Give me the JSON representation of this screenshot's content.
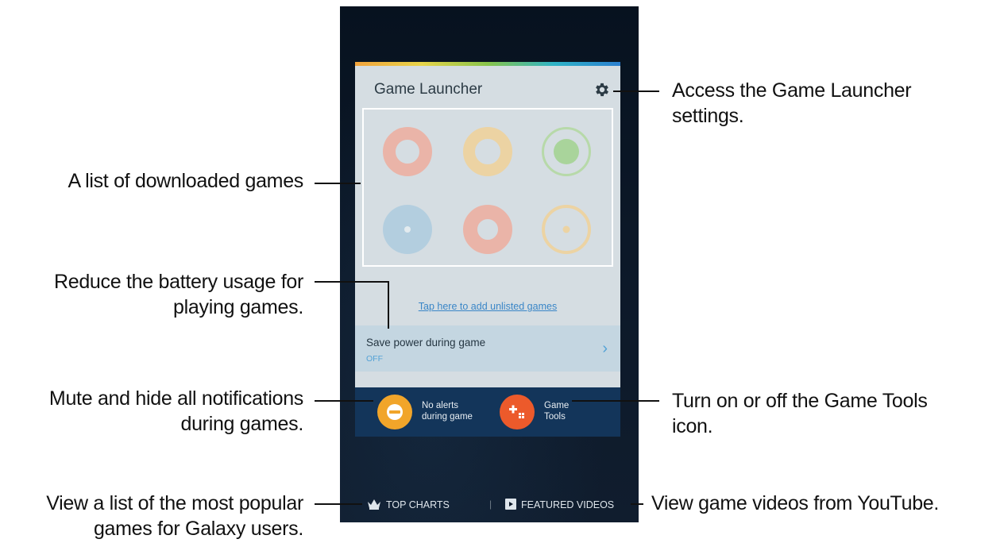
{
  "card": {
    "title": "Game Launcher",
    "settings_icon": "gear-icon",
    "add_link": "Tap here to add unlisted games",
    "save_power": {
      "title": "Save power during game",
      "status": "OFF",
      "chevron_icon": "chevron-right-icon"
    },
    "quick_actions": [
      {
        "label_line1": "No alerts",
        "label_line2": "during game",
        "icon": "minus-circle-icon",
        "color": "#f1a52a"
      },
      {
        "label_line1": "Game",
        "label_line2": "Tools",
        "icon": "gamepad-icon",
        "color": "#ec5a2b"
      }
    ]
  },
  "bottom_nav": {
    "top_charts": "TOP CHARTS",
    "featured_videos": "FEATURED VIDEOS",
    "top_charts_icon": "crown-icon",
    "featured_videos_icon": "video-icon"
  },
  "annotations": {
    "settings_line1": "Access the Game Launcher",
    "settings_line2": "settings.",
    "games_list": "A list of downloaded games",
    "battery_line1": "Reduce the battery usage for",
    "battery_line2": "playing games.",
    "mute_line1": "Mute and hide all notifications",
    "mute_line2": "during games.",
    "tools_line1": "Turn on or off the Game Tools",
    "tools_line2": "icon.",
    "charts_line1": "View a list of the most popular",
    "charts_line2": "games for Galaxy users.",
    "videos": "View game videos from YouTube."
  },
  "colors": {
    "accent_blue": "#3a86c7",
    "quick_action_bar": "#13355a",
    "card_bg": "#d5dde2"
  }
}
